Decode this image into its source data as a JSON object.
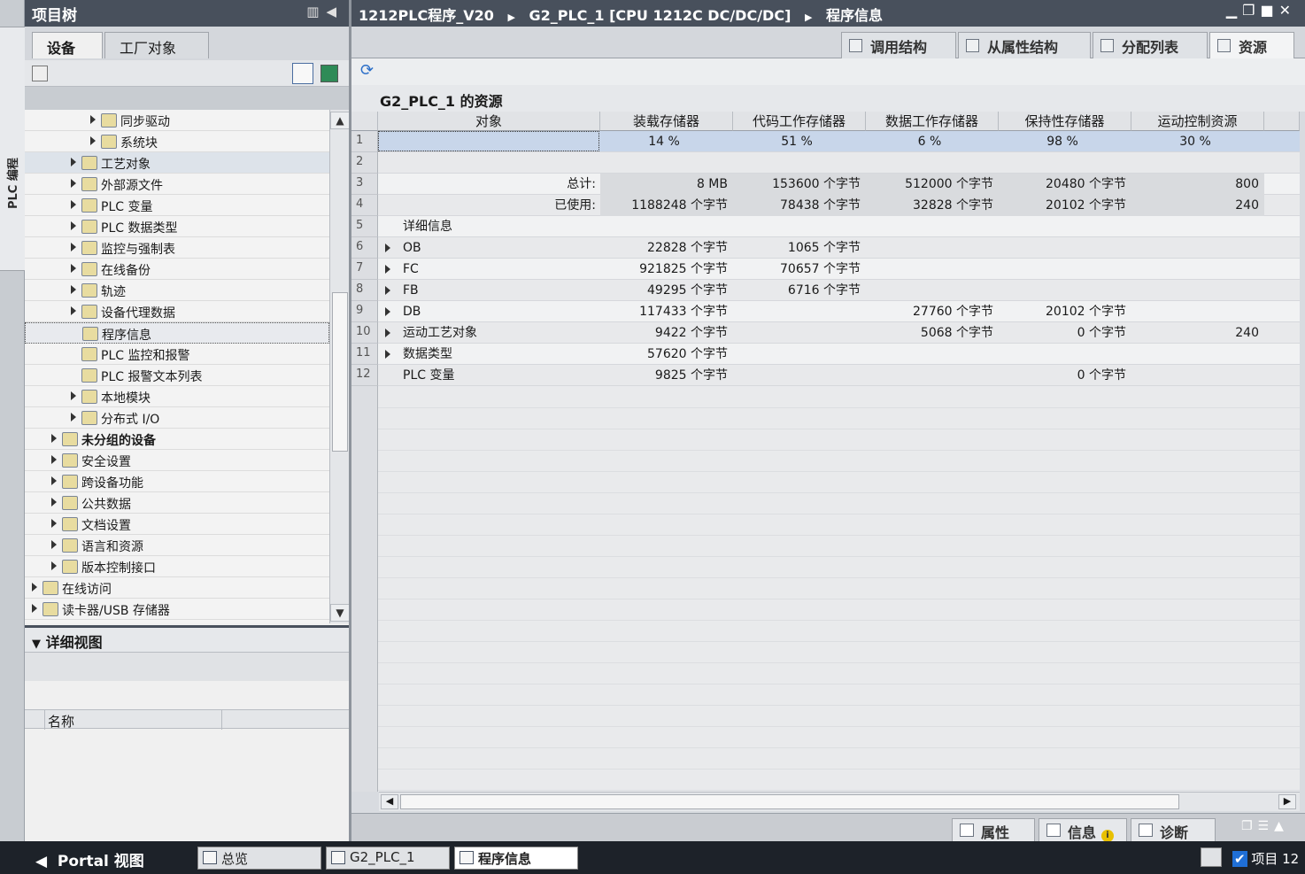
{
  "left_panel": {
    "title": "项目树",
    "vertical_tab": "PLC 编程",
    "tabs": [
      "设备",
      "工厂对象"
    ],
    "tree": [
      {
        "label": "同步驱动",
        "level": 3,
        "arrow": true
      },
      {
        "label": "系统块",
        "level": 3,
        "arrow": true
      },
      {
        "label": "工艺对象",
        "level": 2,
        "arrow": true
      },
      {
        "label": "外部源文件",
        "level": 2,
        "arrow": true
      },
      {
        "label": "PLC 变量",
        "level": 2,
        "arrow": true
      },
      {
        "label": "PLC 数据类型",
        "level": 2,
        "arrow": true
      },
      {
        "label": "监控与强制表",
        "level": 2,
        "arrow": true
      },
      {
        "label": "在线备份",
        "level": 2,
        "arrow": true
      },
      {
        "label": "轨迹",
        "level": 2,
        "arrow": true
      },
      {
        "label": "设备代理数据",
        "level": 2,
        "arrow": true
      },
      {
        "label": "程序信息",
        "level": 2,
        "arrow": false
      },
      {
        "label": "PLC 监控和报警",
        "level": 2,
        "arrow": false
      },
      {
        "label": "PLC 报警文本列表",
        "level": 2,
        "arrow": false
      },
      {
        "label": "本地模块",
        "level": 2,
        "arrow": true
      },
      {
        "label": "分布式 I/O",
        "level": 2,
        "arrow": true
      },
      {
        "label": "未分组的设备",
        "level": 1,
        "arrow": true
      },
      {
        "label": "安全设置",
        "level": 1,
        "arrow": true
      },
      {
        "label": "跨设备功能",
        "level": 1,
        "arrow": true
      },
      {
        "label": "公共数据",
        "level": 1,
        "arrow": true
      },
      {
        "label": "文档设置",
        "level": 1,
        "arrow": true
      },
      {
        "label": "语言和资源",
        "level": 1,
        "arrow": true
      },
      {
        "label": "版本控制接口",
        "level": 1,
        "arrow": true
      },
      {
        "label": "在线访问",
        "level": 0,
        "arrow": true
      },
      {
        "label": "读卡器/USB 存储器",
        "level": 0,
        "arrow": true
      }
    ],
    "detail_view": {
      "title": "详细视图",
      "name_col": "名称"
    }
  },
  "editor": {
    "breadcrumb": [
      "1212PLC程序_V20",
      "G2_PLC_1 [CPU 1212C DC/DC/DC]",
      "程序信息"
    ],
    "tabs": [
      "调用结构",
      "从属性结构",
      "分配列表",
      "资源"
    ],
    "title": "G2_PLC_1 的资源",
    "columns": [
      "对象",
      "装载存储器",
      "代码工作存储器",
      "数据工作存储器",
      "保持性存储器",
      "运动控制资源"
    ],
    "rows": [
      {
        "n": "1",
        "name": "",
        "arrow": false,
        "vals": [
          "14 %",
          "51 %",
          "6 %",
          "98 %",
          "30 %"
        ]
      },
      {
        "n": "2",
        "name": "",
        "arrow": false,
        "vals": [
          "",
          "",
          "",
          "",
          ""
        ]
      },
      {
        "n": "3",
        "name": "总计:",
        "arrow": false,
        "vals": [
          "8 MB",
          "153600 个字节",
          "512000 个字节",
          "20480 个字节",
          "800"
        ]
      },
      {
        "n": "4",
        "name": "已使用:",
        "arrow": false,
        "vals": [
          "1188248 个字节",
          "78438 个字节",
          "32828 个字节",
          "20102 个字节",
          "240"
        ]
      },
      {
        "n": "5",
        "name": "详细信息",
        "arrow": false,
        "vals": [
          "",
          "",
          "",
          "",
          ""
        ]
      },
      {
        "n": "6",
        "name": "OB",
        "arrow": true,
        "vals": [
          "22828 个字节",
          "1065 个字节",
          "",
          "",
          ""
        ]
      },
      {
        "n": "7",
        "name": "FC",
        "arrow": true,
        "vals": [
          "921825 个字节",
          "70657 个字节",
          "",
          "",
          ""
        ]
      },
      {
        "n": "8",
        "name": "FB",
        "arrow": true,
        "vals": [
          "49295 个字节",
          "6716 个字节",
          "",
          "",
          ""
        ]
      },
      {
        "n": "9",
        "name": "DB",
        "arrow": true,
        "vals": [
          "117433 个字节",
          "",
          "27760 个字节",
          "20102 个字节",
          ""
        ]
      },
      {
        "n": "10",
        "name": "运动工艺对象",
        "arrow": true,
        "vals": [
          "9422 个字节",
          "",
          "5068 个字节",
          "0 个字节",
          "240"
        ]
      },
      {
        "n": "11",
        "name": "数据类型",
        "arrow": true,
        "vals": [
          "57620 个字节",
          "",
          "",
          "",
          ""
        ]
      },
      {
        "n": "12",
        "name": "PLC 变量",
        "arrow": false,
        "vals": [
          "9825 个字节",
          "",
          "",
          "0 个字节",
          ""
        ]
      }
    ]
  },
  "bottom_tabs": [
    "属性",
    "信息",
    "诊断"
  ],
  "taskbar": {
    "portal": "Portal 视图",
    "items": [
      "总览",
      "G2_PLC_1",
      "程序信息"
    ],
    "project": "项目 12"
  }
}
